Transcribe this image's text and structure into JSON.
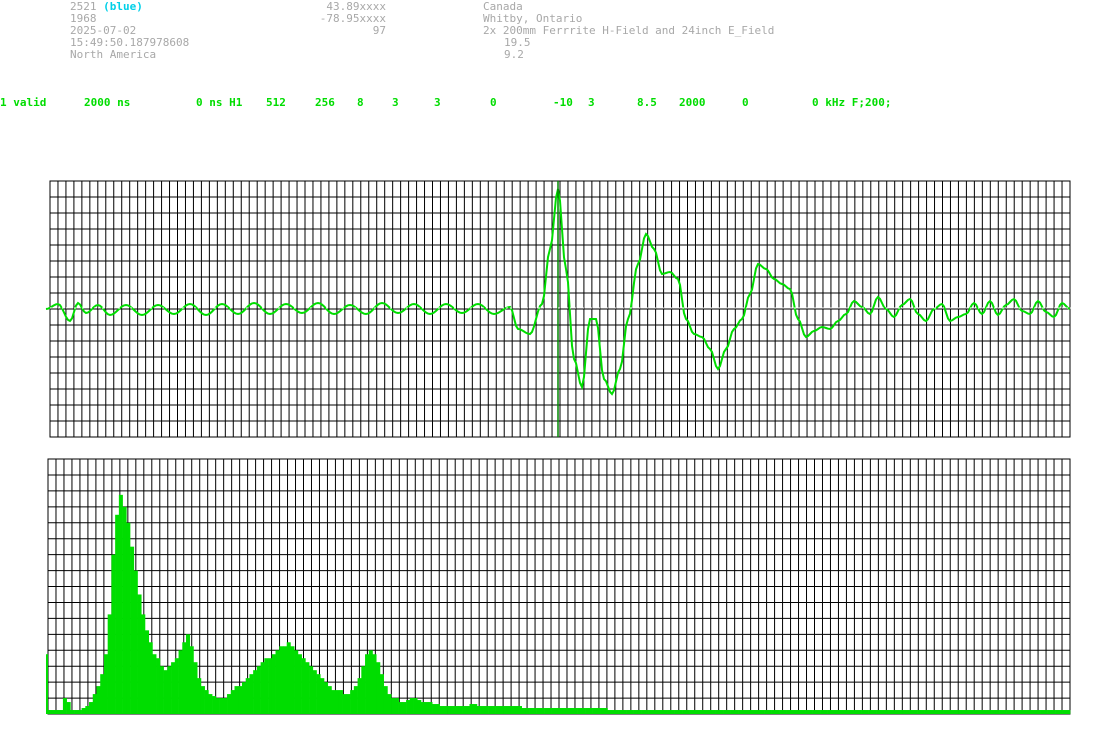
{
  "header": {
    "station_id": "2521",
    "station_color": "(blue)",
    "year_value": "1968",
    "date": "2025-07-02",
    "time": "15:49:50.187978608",
    "region": "North America",
    "latitude": "43.89xxxx",
    "longitude": "-78.95xxxx",
    "elevation": "97",
    "country": "Canada",
    "city": "Whitby, Ontario",
    "antenna": "2x 200mm Ferrrite H-Field and 24inch E_Field",
    "value_a": "19.5",
    "value_b": "9.2"
  },
  "params": {
    "p1": "1 valid",
    "p2": "2000 ns",
    "p3": "0 ns H1",
    "p4": "512",
    "p5": "256",
    "p6": "8",
    "p7": "3",
    "p8": "3",
    "p9": "0",
    "p10": "-10",
    "p11": "3",
    "p12": "8.5",
    "p13": "2000",
    "p14": "0",
    "p15": "0 kHz F;200;"
  },
  "colors": {
    "trace": "#00dd00",
    "grid": "#000000",
    "marker": "#008800",
    "header_text": "#a8a8a8",
    "station_color_text": "#00d0e8"
  },
  "chart_data": [
    {
      "type": "line",
      "description_free": true,
      "x_range": [
        0,
        512
      ],
      "y_range": [
        -128,
        128
      ],
      "grid": true,
      "trigger_index": 256,
      "points": [
        [
          0,
          0
        ],
        [
          6,
          5
        ],
        [
          12,
          -12
        ],
        [
          16,
          6
        ],
        [
          20,
          -4
        ],
        [
          26,
          4
        ],
        [
          32,
          -6
        ],
        [
          40,
          4
        ],
        [
          48,
          -6
        ],
        [
          56,
          4
        ],
        [
          64,
          -5
        ],
        [
          72,
          5
        ],
        [
          80,
          -6
        ],
        [
          88,
          5
        ],
        [
          96,
          -5
        ],
        [
          104,
          6
        ],
        [
          112,
          -5
        ],
        [
          120,
          5
        ],
        [
          128,
          -4
        ],
        [
          136,
          6
        ],
        [
          144,
          -5
        ],
        [
          152,
          4
        ],
        [
          160,
          -5
        ],
        [
          168,
          6
        ],
        [
          176,
          -4
        ],
        [
          184,
          5
        ],
        [
          192,
          -5
        ],
        [
          200,
          5
        ],
        [
          208,
          -4
        ],
        [
          216,
          5
        ],
        [
          224,
          -5
        ],
        [
          232,
          2
        ],
        [
          236,
          -20
        ],
        [
          242,
          -25
        ],
        [
          248,
          5
        ],
        [
          252,
          60
        ],
        [
          256,
          120
        ],
        [
          260,
          40
        ],
        [
          264,
          -50
        ],
        [
          268,
          -78
        ],
        [
          272,
          -10
        ],
        [
          275,
          -10
        ],
        [
          279,
          -70
        ],
        [
          283,
          -85
        ],
        [
          287,
          -60
        ],
        [
          291,
          -10
        ],
        [
          296,
          45
        ],
        [
          300,
          75
        ],
        [
          304,
          60
        ],
        [
          308,
          35
        ],
        [
          312,
          37
        ],
        [
          316,
          30
        ],
        [
          320,
          -10
        ],
        [
          324,
          -25
        ],
        [
          328,
          -28
        ],
        [
          332,
          -40
        ],
        [
          336,
          -60
        ],
        [
          340,
          -40
        ],
        [
          344,
          -20
        ],
        [
          348,
          -10
        ],
        [
          352,
          15
        ],
        [
          356,
          45
        ],
        [
          360,
          40
        ],
        [
          364,
          30
        ],
        [
          368,
          25
        ],
        [
          372,
          20
        ],
        [
          376,
          -10
        ],
        [
          380,
          -28
        ],
        [
          384,
          -22
        ],
        [
          388,
          -18
        ],
        [
          392,
          -20
        ],
        [
          396,
          -12
        ],
        [
          400,
          -5
        ],
        [
          404,
          8
        ],
        [
          408,
          2
        ],
        [
          412,
          -5
        ],
        [
          416,
          12
        ],
        [
          420,
          0
        ],
        [
          424,
          -8
        ],
        [
          428,
          4
        ],
        [
          432,
          10
        ],
        [
          436,
          -5
        ],
        [
          440,
          -12
        ],
        [
          444,
          0
        ],
        [
          448,
          5
        ],
        [
          452,
          -12
        ],
        [
          456,
          -8
        ],
        [
          460,
          -5
        ],
        [
          464,
          6
        ],
        [
          468,
          -5
        ],
        [
          472,
          8
        ],
        [
          476,
          -6
        ],
        [
          480,
          4
        ],
        [
          484,
          10
        ],
        [
          488,
          -2
        ],
        [
          492,
          -5
        ],
        [
          496,
          8
        ],
        [
          500,
          -3
        ],
        [
          504,
          -8
        ],
        [
          508,
          6
        ],
        [
          512,
          0
        ]
      ]
    },
    {
      "type": "bar",
      "x_range": [
        0,
        512
      ],
      "y_range": [
        0,
        128
      ],
      "grid": true,
      "values": [
        2,
        2,
        2,
        2,
        8,
        6,
        2,
        2,
        2,
        3,
        4,
        6,
        10,
        14,
        20,
        30,
        50,
        80,
        100,
        110,
        104,
        96,
        84,
        72,
        60,
        50,
        42,
        36,
        30,
        28,
        24,
        22,
        24,
        26,
        28,
        32,
        36,
        40,
        34,
        26,
        18,
        14,
        12,
        10,
        9,
        8,
        8,
        8,
        10,
        12,
        14,
        14,
        16,
        18,
        20,
        22,
        24,
        26,
        28,
        28,
        30,
        32,
        34,
        34,
        36,
        34,
        32,
        30,
        28,
        26,
        24,
        22,
        20,
        18,
        16,
        14,
        12,
        12,
        12,
        10,
        10,
        12,
        14,
        18,
        24,
        30,
        32,
        30,
        26,
        20,
        14,
        10,
        8,
        8,
        6,
        6,
        7,
        8,
        8,
        7,
        6,
        6,
        6,
        5,
        5,
        4,
        4,
        4,
        4,
        4,
        4,
        4,
        4,
        5,
        5,
        4,
        4,
        4,
        4,
        4,
        4,
        4,
        4,
        4,
        4,
        4,
        4,
        3,
        3,
        3,
        3,
        3,
        3,
        3,
        3,
        3,
        3,
        3,
        3,
        3,
        3,
        3,
        3,
        3,
        3,
        3,
        3,
        3,
        3,
        3,
        2,
        2,
        2,
        2,
        2,
        2,
        2,
        2,
        2,
        2,
        2,
        2,
        2,
        2,
        2,
        2,
        2,
        2,
        2,
        2,
        2,
        2,
        2,
        2,
        2,
        2,
        2,
        2,
        2,
        2,
        2,
        2,
        2,
        2,
        2,
        2,
        2,
        2,
        2,
        2,
        2,
        2,
        2,
        2,
        2,
        2,
        2,
        2,
        2,
        2,
        2,
        2,
        2,
        2,
        2,
        2,
        2,
        2,
        2,
        2,
        2,
        2,
        2,
        2,
        2,
        2,
        2,
        2,
        2,
        2,
        2,
        2,
        2,
        2,
        2,
        2,
        2,
        2,
        2,
        2,
        2,
        2,
        2,
        2,
        2,
        2,
        2,
        2,
        2,
        2,
        2,
        2,
        2,
        2,
        2,
        2,
        2,
        2,
        2,
        2,
        2,
        2,
        2,
        2,
        2,
        2,
        2,
        2,
        2,
        2,
        2,
        2,
        2,
        2,
        2,
        2,
        2,
        2,
        2,
        2,
        2,
        2,
        2,
        2
      ],
      "first_value": 30
    }
  ]
}
